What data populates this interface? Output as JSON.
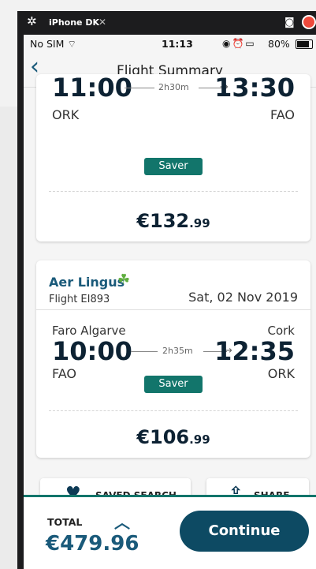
{
  "simulator": {
    "title": "iPhone DK",
    "close_glyph": "✕"
  },
  "status_bar": {
    "carrier": "No SIM",
    "time": "11:13",
    "battery": "80%"
  },
  "nav": {
    "title": "Flight Summary",
    "back_glyph": "‹"
  },
  "card1": {
    "depart_time": "11:00",
    "arrive_time": "13:30",
    "duration": "2h30m",
    "depart_code": "ORK",
    "arrive_code": "FAO",
    "fare": "Saver",
    "price_main": "€132",
    "price_cents": ".99"
  },
  "card2": {
    "airline": "Aer Lingus",
    "flight_number": "Flight EI893",
    "date": "Sat, 02 Nov 2019",
    "depart_city": "Faro Algarve",
    "arrive_city": "Cork",
    "depart_time": "10:00",
    "arrive_time": "12:35",
    "duration": "2h35m",
    "depart_code": "FAO",
    "arrive_code": "ORK",
    "fare": "Saver",
    "price_main": "€106",
    "price_cents": ".99"
  },
  "actions": {
    "saved_search": "SAVED SEARCH",
    "share": "SHARE"
  },
  "footer": {
    "total_label": "TOTAL",
    "total_amount": "€479.96",
    "continue": "Continue"
  },
  "colors": {
    "primary": "#0d4a63",
    "saver": "#12756b",
    "accent": "#1a5a7a"
  }
}
